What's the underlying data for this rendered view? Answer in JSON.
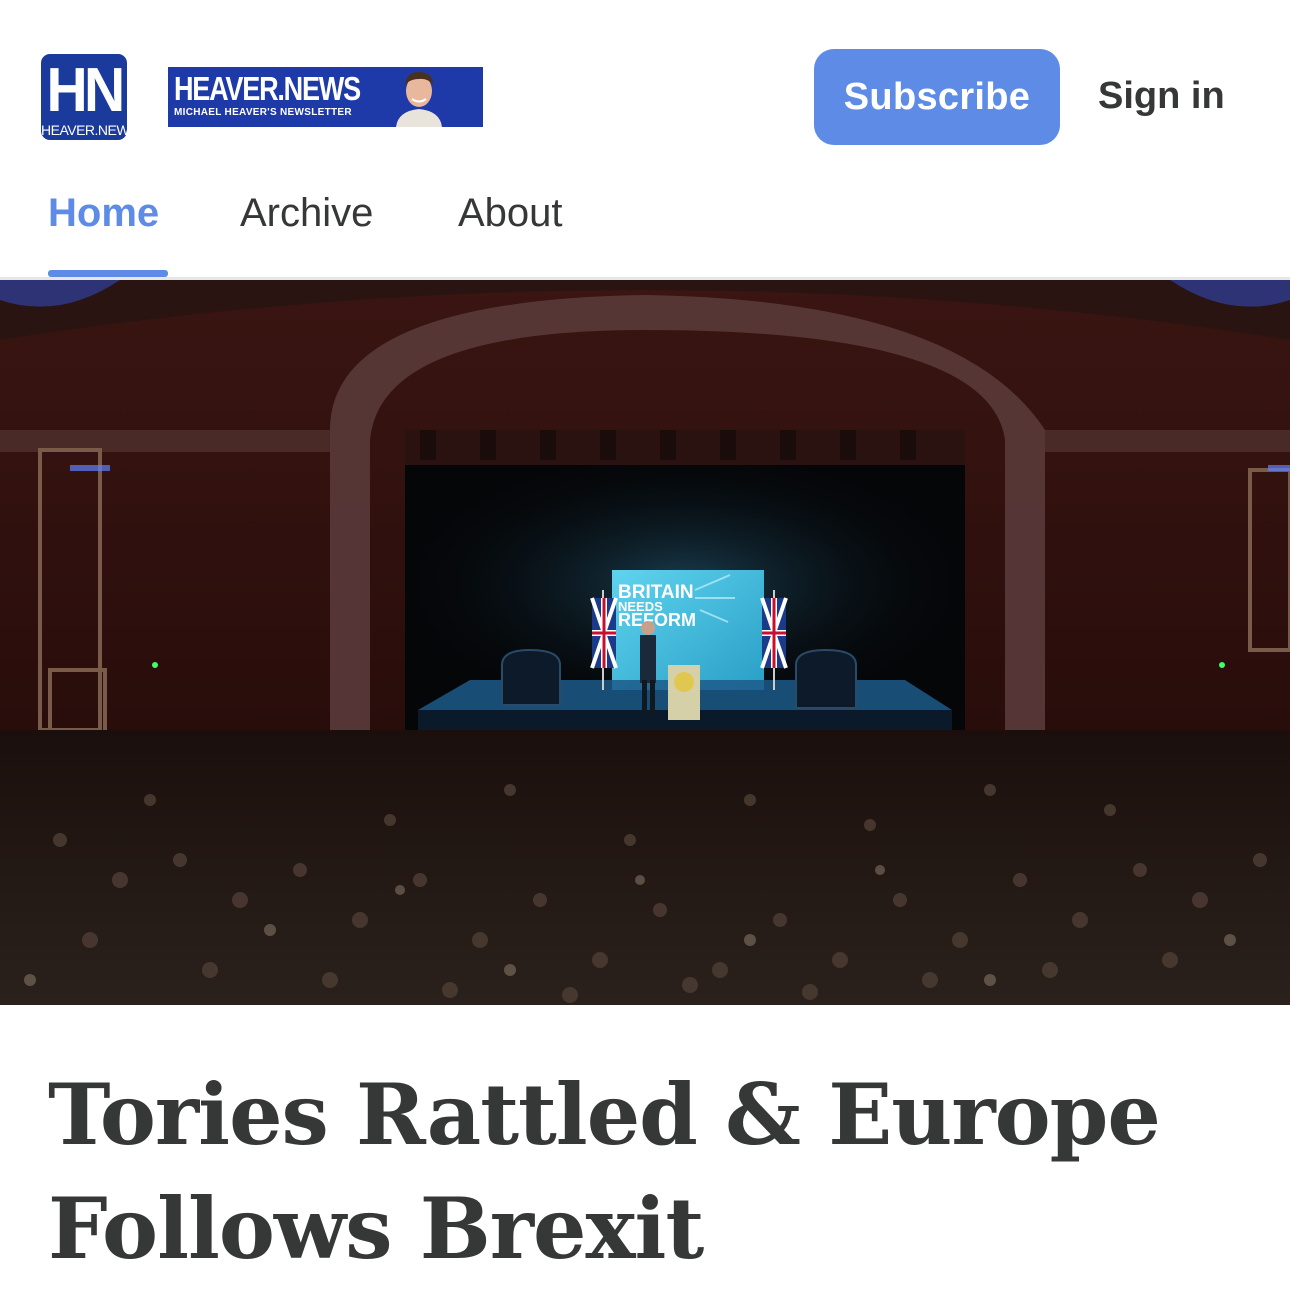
{
  "header": {
    "logo_mark": "HN",
    "logo_sub": "HEAVER.NEWS",
    "wordmark_title": "HEAVER.NEWS",
    "wordmark_tagline": "MICHAEL HEAVER'S NEWSLETTER",
    "subscribe_label": "Subscribe",
    "signin_label": "Sign in"
  },
  "nav": {
    "tabs": [
      {
        "label": "Home",
        "active": true
      },
      {
        "label": "Archive",
        "active": false
      },
      {
        "label": "About",
        "active": false
      }
    ]
  },
  "hero": {
    "backdrop_text": [
      "BRITAIN",
      "NEEDS",
      "REFORM"
    ]
  },
  "article": {
    "headline": "Tories Rattled & Europe Follows Brexit"
  },
  "colors": {
    "accent": "#5d8be6",
    "text": "#363737",
    "brand_blue": "#1e3aa8"
  }
}
